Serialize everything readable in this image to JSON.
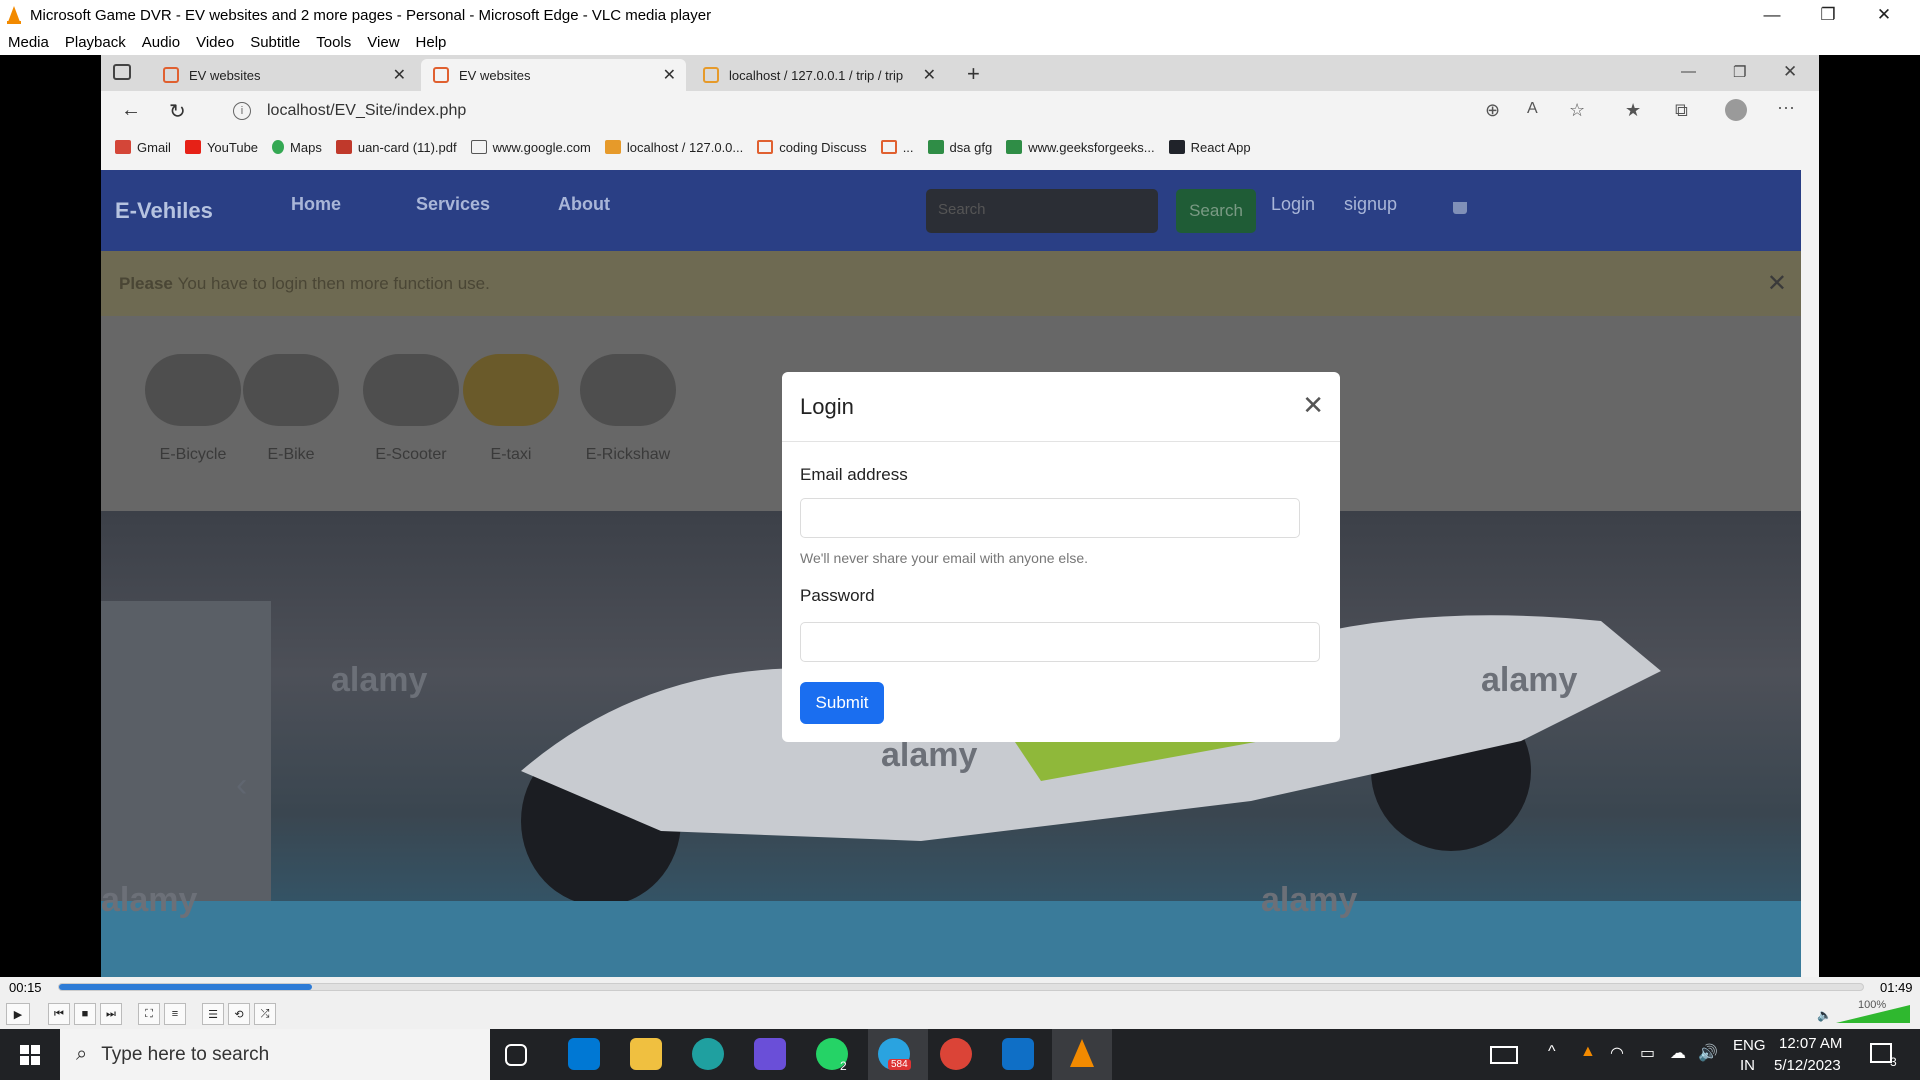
{
  "window": {
    "title": "Microsoft Game DVR - EV websites and 2 more pages - Personal - Microsoft Edge - VLC media player",
    "min": "—",
    "max": "❐",
    "close": "✕"
  },
  "menu": [
    "Media",
    "Playback",
    "Audio",
    "Video",
    "Subtitle",
    "Tools",
    "View",
    "Help"
  ],
  "browser": {
    "tabs": [
      {
        "label": "EV websites"
      },
      {
        "label": "EV websites"
      },
      {
        "label": "localhost / 127.0.0.1 / trip / trip"
      }
    ],
    "url": "localhost/EV_Site/index.php",
    "bookmarks": [
      "Gmail",
      "YouTube",
      "Maps",
      "uan-card (11).pdf",
      "www.google.com",
      "localhost / 127.0.0...",
      "coding Discuss",
      "...",
      "dsa gfg",
      "www.geeksforgeeks...",
      "React App"
    ]
  },
  "site": {
    "brand": "E-Vehiles",
    "nav": [
      "Home",
      "Services",
      "About"
    ],
    "search_placeholder": "Search",
    "search_button": "Search",
    "login": "Login",
    "signup": "signup",
    "cart_icon": "cart-icon",
    "alert_strong": "Please",
    "alert_text": "You have to login then more function use.",
    "categories": [
      "E-Bicycle",
      "E-Bike",
      "E-Scooter",
      "E-taxi",
      "E-Rickshaw"
    ],
    "watermark": "alamy"
  },
  "modal": {
    "title": "Login",
    "email_label": "Email address",
    "email_help": "We'll never share your email with anyone else.",
    "password_label": "Password",
    "submit": "Submit"
  },
  "player": {
    "elapsed": "00:15",
    "total": "01:49",
    "progress": 0.14,
    "volume": "100%"
  },
  "taskbar": {
    "search_placeholder": "Type here to search",
    "lang1": "ENG",
    "lang2": "IN",
    "time": "12:07 AM",
    "date": "5/12/2023",
    "telegram_badge": "584",
    "whatsapp_badge": "2",
    "notif_badge": "3"
  },
  "colors": {
    "brand_nav": "#2a3f85",
    "submit": "#1a6ef0",
    "vlc_orange": "#f28a00"
  }
}
